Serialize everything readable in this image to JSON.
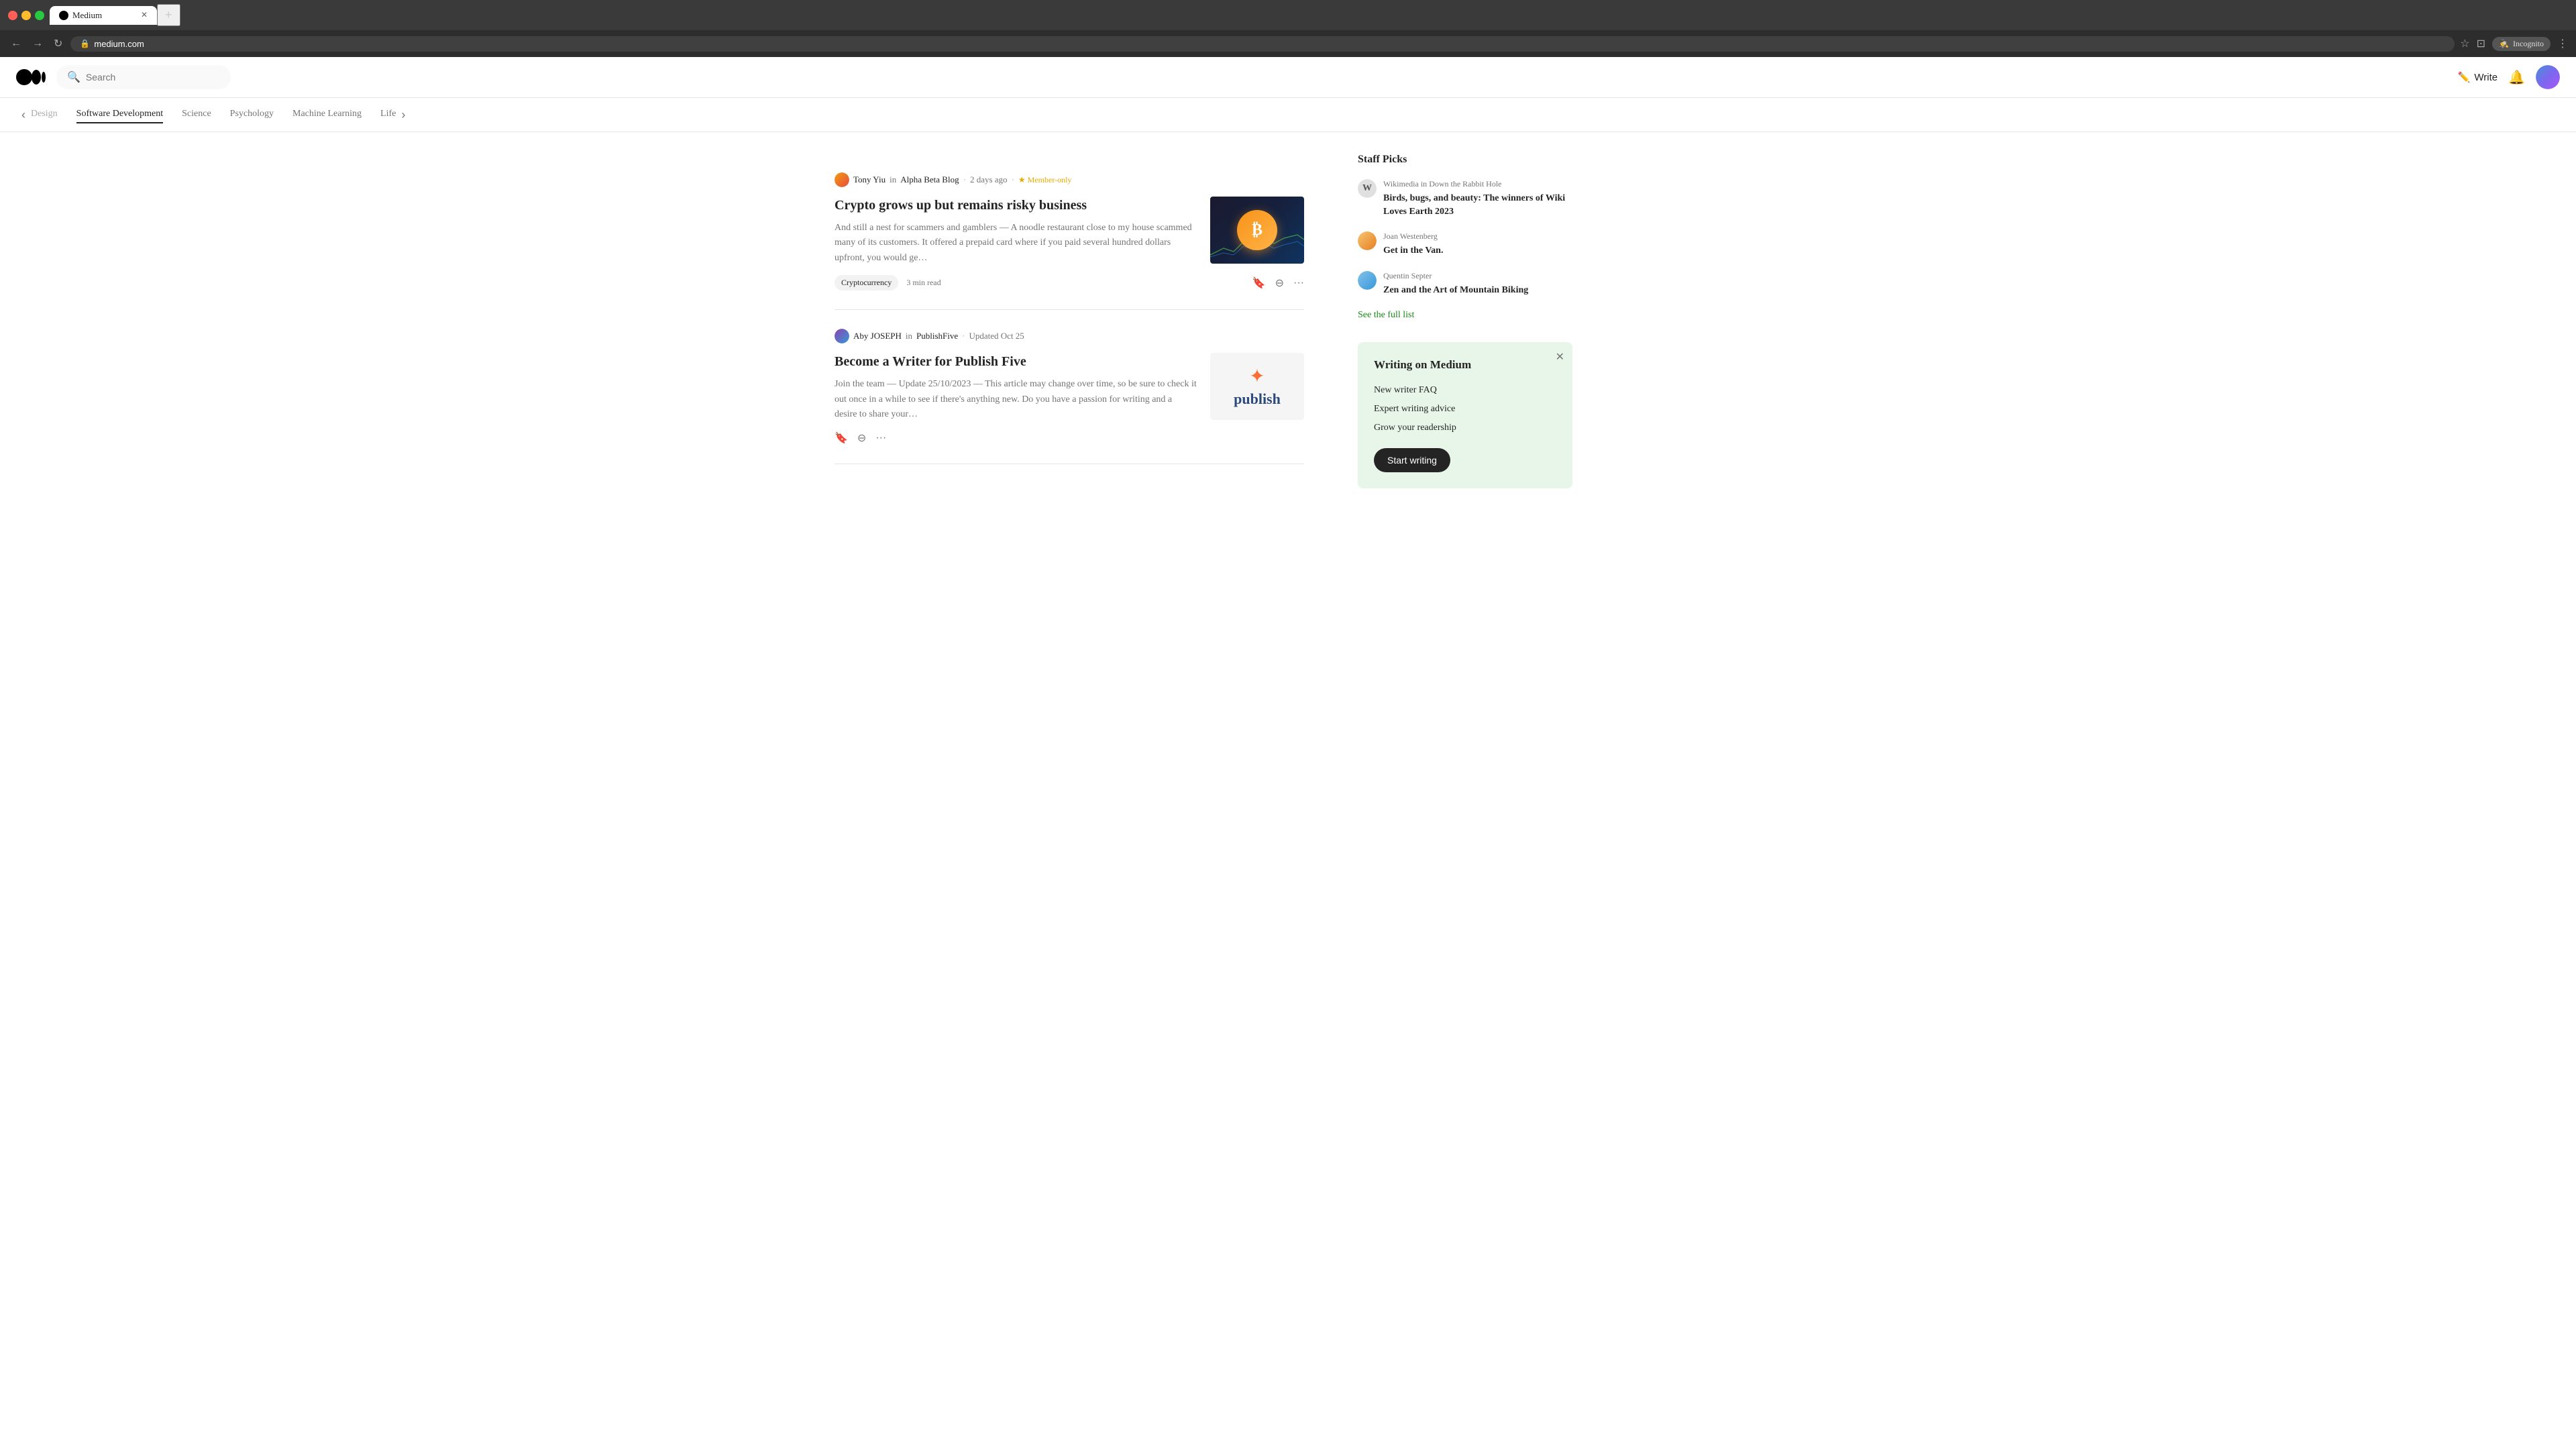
{
  "browser": {
    "tab_title": "Medium",
    "url": "medium.com",
    "new_tab_label": "+",
    "incognito_label": "Incognito",
    "nav_back": "←",
    "nav_forward": "→",
    "nav_reload": "↻"
  },
  "medium": {
    "logo_text": "Medium",
    "search_placeholder": "Search",
    "write_label": "Write",
    "categories": [
      {
        "id": "design",
        "label": "Design"
      },
      {
        "id": "software-dev",
        "label": "Software Development"
      },
      {
        "id": "science",
        "label": "Science"
      },
      {
        "id": "psychology",
        "label": "Psychology"
      },
      {
        "id": "machine-learning",
        "label": "Machine Learning"
      },
      {
        "id": "life",
        "label": "Life"
      }
    ],
    "staff_picks": {
      "title": "Staff Picks",
      "see_full_list_label": "See the full list",
      "items": [
        {
          "author": "Wikimedia",
          "publication": "Down the Rabbit Hole",
          "title": "Birds, bugs, and beauty: The winners of Wiki Loves Earth 2023"
        },
        {
          "author": "Joan Westenberg",
          "publication": "",
          "title": "Get in the Van."
        },
        {
          "author": "Quentin Septer",
          "publication": "",
          "title": "Zen and the Art of Mountain Biking"
        }
      ]
    },
    "writing_card": {
      "title": "Writing on Medium",
      "links": [
        "New writer FAQ",
        "Expert writing advice",
        "Grow your readership"
      ],
      "cta_label": "Start writing"
    },
    "articles": [
      {
        "id": "crypto",
        "author_name": "Tony Yiu",
        "publication": "Alpha Beta Blog",
        "time_ago": "2 days ago",
        "member_only": true,
        "member_label": "Member-only",
        "title": "Crypto grows up but remains risky business",
        "excerpt": "And still a nest for scammers and gamblers — A noodle restaurant close to my house scammed many of its customers. It offered a prepaid card where if you paid several hundred dollars upfront, you would ge…",
        "tag": "Cryptocurrency",
        "read_time": "3 min read",
        "actions": {
          "save": "bookmark",
          "hide": "minus-circle",
          "more": "ellipsis"
        }
      },
      {
        "id": "publish",
        "author_name": "Aby JOSEPH",
        "publication": "PublishFive",
        "time_ago": "Updated Oct 25",
        "member_only": false,
        "title": "Become a Writer for Publish Five",
        "excerpt": "Join the team — Update 25/10/2023 — This article may change over time, so be sure to check it out once in a while to see if there's anything new. Do you have a passion for writing and a desire to share your…",
        "tag": "",
        "read_time": "",
        "actions": {
          "save": "bookmark",
          "hide": "minus-circle",
          "more": "ellipsis"
        }
      }
    ]
  }
}
